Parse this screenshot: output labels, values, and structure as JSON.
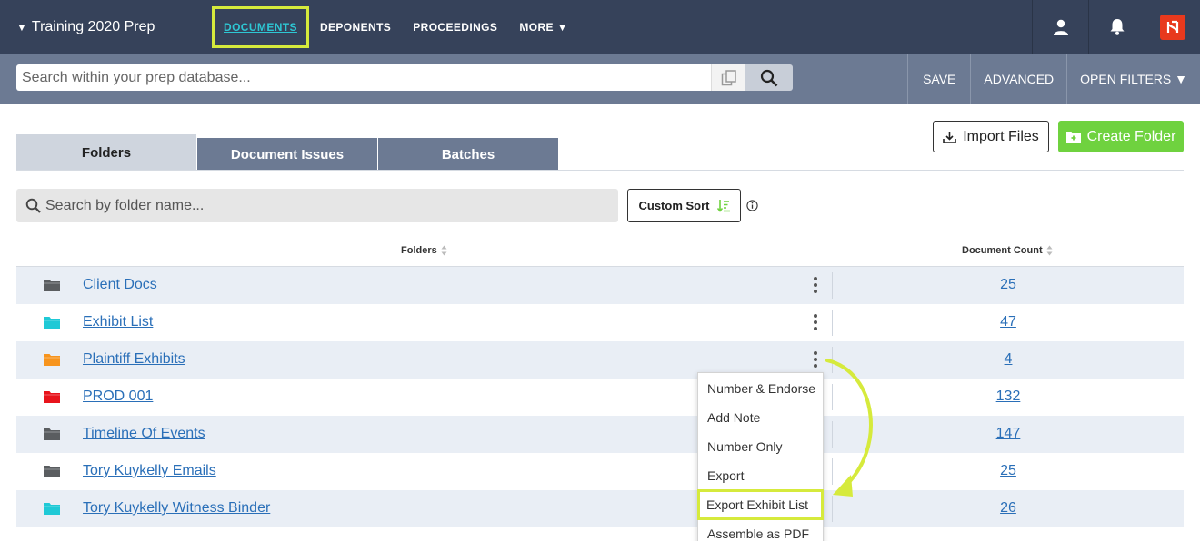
{
  "nav": {
    "project": "Training 2020 Prep",
    "links": [
      "DOCUMENTS",
      "DEPONENTS",
      "PROCEEDINGS",
      "MORE ▼"
    ],
    "active": "DOCUMENTS"
  },
  "search": {
    "placeholder": "Search within your prep database...",
    "save": "SAVE",
    "advanced": "ADVANCED",
    "open_filters": "OPEN FILTERS ▼"
  },
  "actions": {
    "import": "Import Files",
    "create": "Create Folder"
  },
  "tabs": [
    "Folders",
    "Document Issues",
    "Batches"
  ],
  "folder_search": {
    "placeholder": "Search by folder name...",
    "custom_sort": "Custom Sort"
  },
  "table": {
    "headers": {
      "folders": "Folders",
      "count": "Document Count"
    },
    "rows": [
      {
        "name": "Client Docs",
        "count": "25",
        "color": "#5a5d60"
      },
      {
        "name": "Exhibit List",
        "count": "47",
        "color": "#1fc9d6"
      },
      {
        "name": "Plaintiff Exhibits",
        "count": "4",
        "color": "#f7941d"
      },
      {
        "name": "PROD 001",
        "count": "132",
        "color": "#e8141c"
      },
      {
        "name": "Timeline Of Events",
        "count": "147",
        "color": "#5a5d60"
      },
      {
        "name": "Tory Kuykelly Emails",
        "count": "25",
        "color": "#5a5d60"
      },
      {
        "name": "Tory Kuykelly Witness Binder",
        "count": "26",
        "color": "#1fc9d6"
      }
    ]
  },
  "menu": {
    "items": [
      "Number & Endorse",
      "Add Note",
      "Number Only",
      "Export",
      "Export Exhibit List",
      "Assemble as PDF"
    ],
    "highlighted": "Export Exhibit List"
  },
  "colors": {
    "nav_bg": "#36425a",
    "search_bg": "#6c7a93",
    "accent_teal": "#2ec7d4",
    "highlight_lime": "#d6ea3c",
    "create_green": "#6fd23f",
    "link_blue": "#2a6fb8"
  }
}
